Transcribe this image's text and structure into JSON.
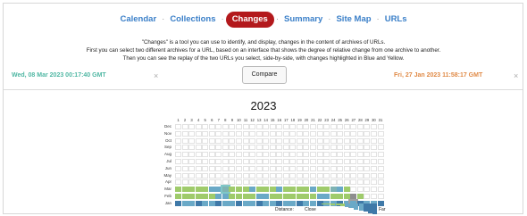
{
  "nav": {
    "items": [
      "Calendar",
      "Collections",
      "Changes",
      "Summary",
      "Site Map",
      "URLs"
    ],
    "active": "Changes",
    "separator": "·"
  },
  "description": {
    "line1": "\"Changes\" is a tool you can use to identify, and display, changes in the content of archives of URLs.",
    "line2": "First you can select two different archives for a URL, based on an interface that shows the degree of relative change from one archive to another.",
    "line3": "Then you can see the replay of the two URLs you select, side-by-side, with changes highlighted in Blue and Yellow."
  },
  "selection": {
    "left_date": "Wed, 08 Mar 2023 00:17:40 GMT",
    "right_date": "Fri, 27 Jan 2023 11:58:17 GMT",
    "clear_icon": "×",
    "compare_label": "Compare"
  },
  "calendar": {
    "year": "2023",
    "days": [
      "1",
      "2",
      "3",
      "4",
      "5",
      "6",
      "7",
      "8",
      "9",
      "10",
      "11",
      "12",
      "13",
      "14",
      "15",
      "16",
      "17",
      "18",
      "19",
      "20",
      "21",
      "22",
      "23",
      "24",
      "25",
      "26",
      "27",
      "28",
      "29",
      "30",
      "31"
    ],
    "months": [
      "Dec",
      "Nov",
      "Oct",
      "Sep",
      "Aug",
      "Jul",
      "Jun",
      "May",
      "Apr",
      "Mar",
      "Feb",
      "Jan"
    ],
    "captures": {
      "Mar": [
        1,
        1,
        1,
        1,
        1,
        2,
        2,
        3,
        1,
        1,
        1,
        2,
        1,
        1,
        1,
        2,
        1,
        1,
        1,
        1,
        2,
        1,
        1,
        3,
        2,
        1,
        0,
        0,
        0,
        0,
        0
      ],
      "Feb": [
        1,
        1,
        1,
        1,
        1,
        1,
        2,
        2,
        1,
        1,
        1,
        1,
        2,
        2,
        1,
        1,
        1,
        1,
        1,
        1,
        1,
        2,
        2,
        1,
        1,
        1,
        4,
        1,
        0,
        0,
        0
      ],
      "Jan": [
        2,
        2,
        2,
        2,
        2,
        2,
        2,
        2,
        2,
        2,
        2,
        2,
        2,
        2,
        2,
        2,
        2,
        2,
        2,
        2,
        2,
        2,
        2,
        2,
        2,
        2,
        2,
        2,
        2,
        2,
        2
      ]
    },
    "selected_left": {
      "month": "Mar",
      "day": 8
    },
    "selected_right": {
      "month": "Jan",
      "day": 27
    },
    "colors": {
      "empty": "#ffffff",
      "close": "#9fcb6b",
      "mid": "#6aa9c7",
      "far": "#3f79a8",
      "highlight": "#7fb3b3",
      "grey": "#8e8e8e"
    }
  },
  "legend": {
    "label": "Distance:",
    "close_label": "Close",
    "far_label": "Far",
    "levels": [
      0.05,
      0.1,
      0.15,
      0.2,
      0.28,
      0.36,
      0.45,
      0.55,
      0.66,
      0.78,
      0.9,
      1.0
    ]
  }
}
